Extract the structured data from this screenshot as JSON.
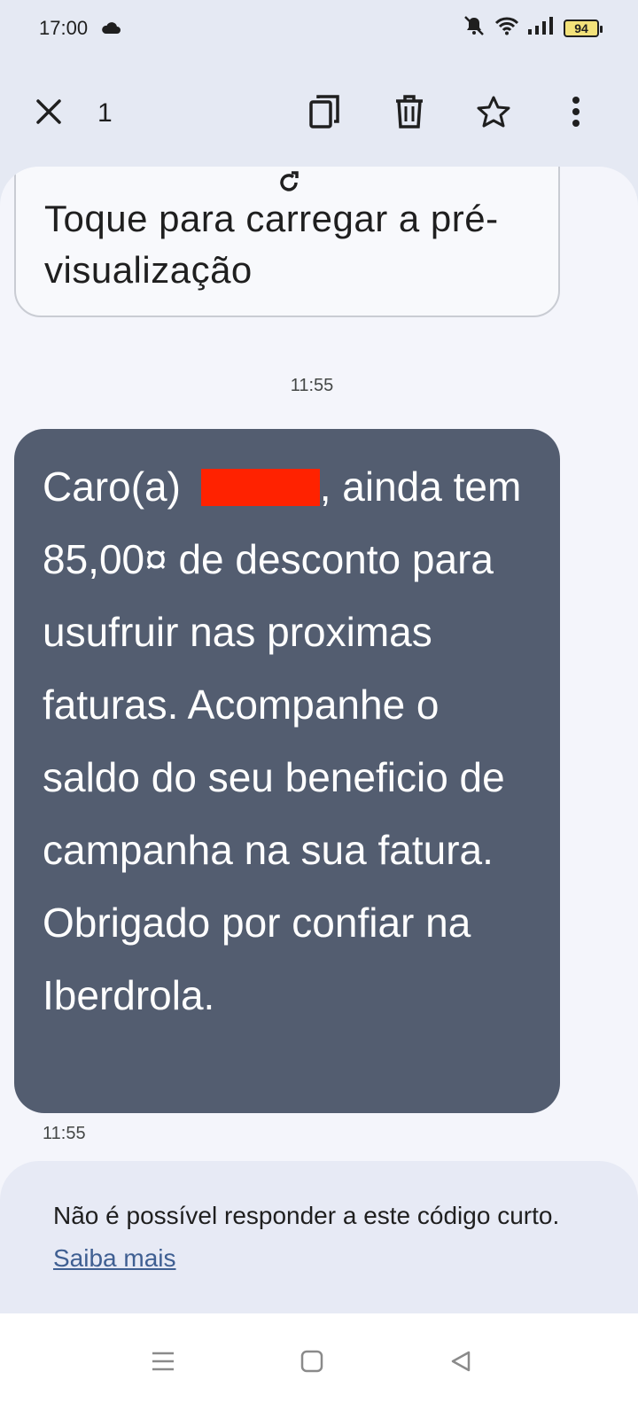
{
  "status_bar": {
    "time": "17:00",
    "battery": "94",
    "icons": [
      "cloud-icon",
      "mute-icon",
      "wifi-icon",
      "signal-icon",
      "battery-icon"
    ]
  },
  "toolbar": {
    "selected_count": "1",
    "icons": [
      "close-icon",
      "copy-icon",
      "delete-icon",
      "star-icon",
      "more-vert-icon"
    ]
  },
  "preview": {
    "text": "Toque para carregar a pré-visualização"
  },
  "conversation": {
    "timestamp_header": "11:55",
    "message": {
      "prefix": "Caro(a) ",
      "suffix": ", ainda tem 85,00¤ de desconto para usufruir nas proximas faturas. Acompanhe o saldo do seu beneficio de campanha na sua fatura. Obrigado por confiar na Iberdrola.",
      "timestamp": "11:55"
    }
  },
  "notice": {
    "text": "Não é possível responder a este código curto. ",
    "link": "Saiba mais"
  },
  "colors": {
    "background": "#e5e9f3",
    "content": "#f4f5fb",
    "bubble": "#535d70",
    "redaction": "#ff2200",
    "link": "#3f5f92"
  }
}
